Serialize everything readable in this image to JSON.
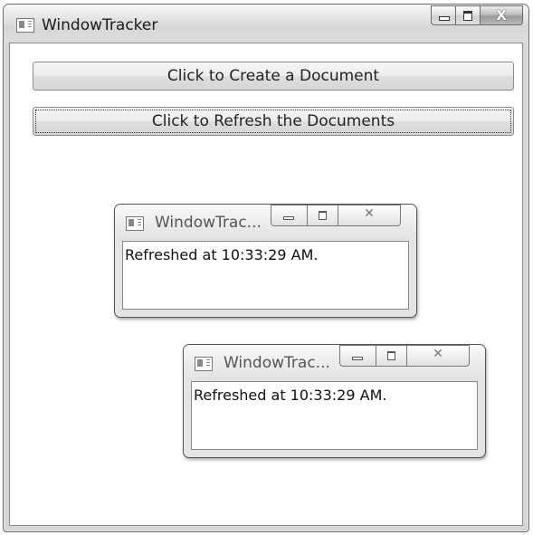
{
  "main_window": {
    "title": "WindowTracker",
    "close_glyph": "X"
  },
  "buttons": {
    "create_label": "Click to Create a Document",
    "refresh_label": "Click to Refresh the Documents"
  },
  "documents": [
    {
      "title": "WindowTrac...",
      "close_glyph": "✕",
      "content": "Refreshed at 10:33:29 AM."
    },
    {
      "title": "WindowTrac...",
      "close_glyph": "✕",
      "content": "Refreshed at 10:33:29 AM."
    }
  ],
  "icons": {
    "app": "app-window-icon",
    "minimize": "minimize-icon",
    "maximize": "maximize-icon",
    "close": "close-icon"
  }
}
